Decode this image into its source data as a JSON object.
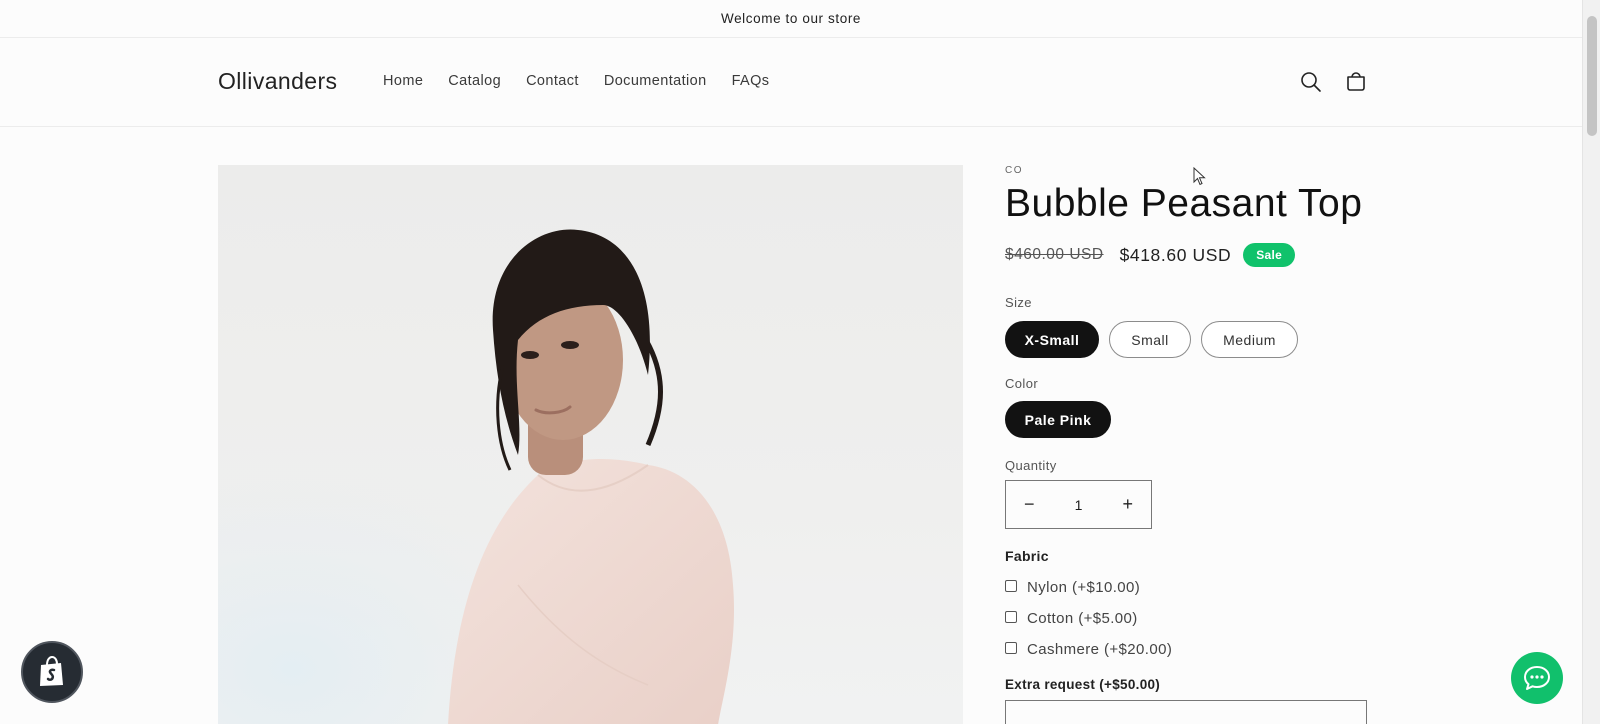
{
  "announcement": {
    "text": "Welcome to our store"
  },
  "header": {
    "logo": "Ollivanders",
    "nav": [
      "Home",
      "Catalog",
      "Contact",
      "Documentation",
      "FAQs"
    ],
    "icons": [
      "search-icon",
      "cart-icon"
    ]
  },
  "product": {
    "vendor": "CO",
    "title": "Bubble Peasant Top",
    "price_original": "$460.00 USD",
    "price_sale": "$418.60 USD",
    "badge": "Sale",
    "size": {
      "label": "Size",
      "options": [
        "X-Small",
        "Small",
        "Medium"
      ],
      "selected": "X-Small"
    },
    "color": {
      "label": "Color",
      "options": [
        "Pale Pink"
      ],
      "selected": "Pale Pink"
    },
    "quantity": {
      "label": "Quantity",
      "value": "1",
      "decrement": "−",
      "increment": "+"
    },
    "fabric": {
      "label": "Fabric",
      "options": [
        {
          "name": "Nylon",
          "price": "(+$10.00)"
        },
        {
          "name": "Cotton",
          "price": "(+$5.00)"
        },
        {
          "name": "Cashmere",
          "price": "(+$20.00)"
        }
      ]
    },
    "extra_request": {
      "label": "Extra request (+$50.00)"
    }
  },
  "colors": {
    "sale_badge": "#10c26b",
    "selected_pill": "#121212",
    "chat_button": "#11c06c"
  },
  "widgets": [
    "shopify-bag-icon",
    "chat-bubble-icon"
  ]
}
